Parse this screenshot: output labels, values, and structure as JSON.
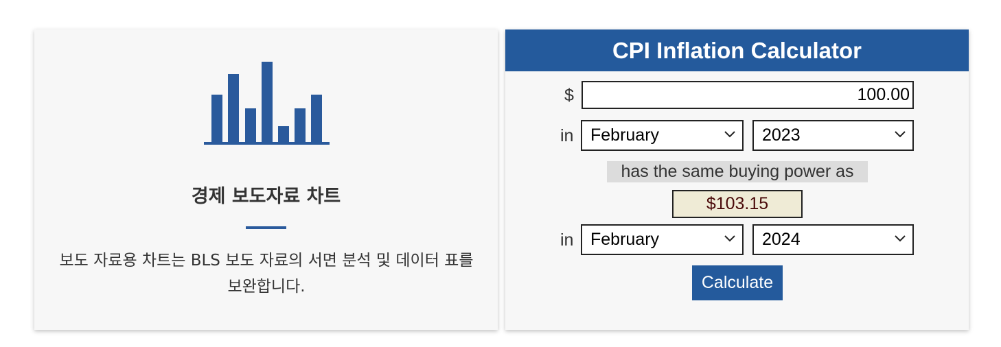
{
  "left_card": {
    "title": "경제 보도자료 차트",
    "description": "보도 자료용 차트는 BLS 보도 자료의 서면 분석 및 데이터 표를 보완합니다.",
    "icon": "bar-chart-icon",
    "accent_color": "#2a5a9c"
  },
  "calculator": {
    "title": "CPI Inflation Calculator",
    "currency_symbol": "$",
    "amount_value": "100.00",
    "in_label_1": "in",
    "from_month": "February",
    "from_year": "2023",
    "same_power_text": "has the same buying power as",
    "result_value": "$103.15",
    "in_label_2": "in",
    "to_month": "February",
    "to_year": "2024",
    "button_label": "Calculate",
    "header_color": "#245a9c",
    "result_bg": "#efebd6"
  }
}
